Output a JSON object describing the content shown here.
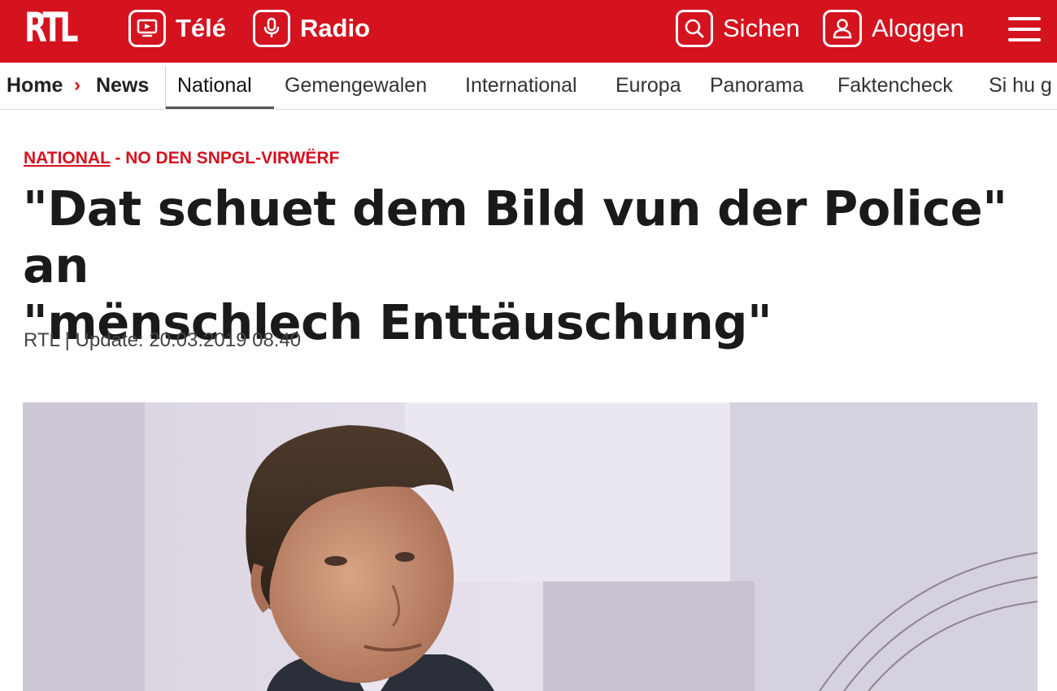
{
  "header": {
    "logo": "RTL",
    "tele_label": "Télé",
    "radio_label": "Radio",
    "search_label": "Sichen",
    "login_label": "Aloggen",
    "accent_color": "#d4131f"
  },
  "breadcrumb": {
    "home": "Home",
    "separator": "›",
    "news": "News"
  },
  "sections": [
    "National",
    "Gemengewalen",
    "International",
    "Europa",
    "Panorama",
    "Faktencheck",
    "Si hu g"
  ],
  "article": {
    "kicker_section": "NATIONAL",
    "kicker_topic": " - NO DEN SNPGL-VIRWËRF",
    "headline_line1": "\"Dat schuet dem Bild vun der Police\" an",
    "headline_line2": "\"mënschlech Enttäuschung\"",
    "byline": "RTL | Update: 20.03.2019 08:40"
  },
  "icons": {
    "tele": "tv-play-icon",
    "radio": "microphone-icon",
    "search": "search-icon",
    "login": "user-icon",
    "menu": "hamburger-menu-icon"
  }
}
